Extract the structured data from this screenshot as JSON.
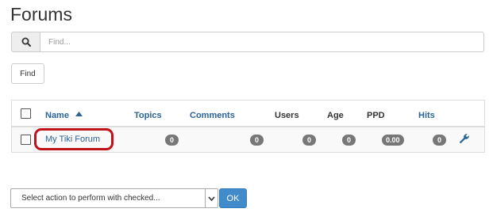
{
  "page": {
    "title": "Forums"
  },
  "search": {
    "placeholder": "Find...",
    "icon": "search-icon",
    "find_label": "Find"
  },
  "table": {
    "headers": {
      "name": "Name",
      "topics": "Topics",
      "comments": "Comments",
      "users": "Users",
      "age": "Age",
      "ppd": "PPD",
      "hits": "Hits"
    },
    "sort": {
      "column": "name",
      "direction": "ascending"
    },
    "rows": [
      {
        "name": "My Tiki Forum",
        "topics": "0",
        "comments": "0",
        "users": "0",
        "age": "0",
        "ppd": "0.00",
        "hits": "0",
        "highlighted": true
      }
    ]
  },
  "actions": {
    "select_label": "Select action to perform with checked...",
    "ok_label": "OK"
  },
  "colors": {
    "link": "#2a6496",
    "badge": "#777777",
    "highlight": "#c0101a",
    "primary": "#428bca"
  }
}
